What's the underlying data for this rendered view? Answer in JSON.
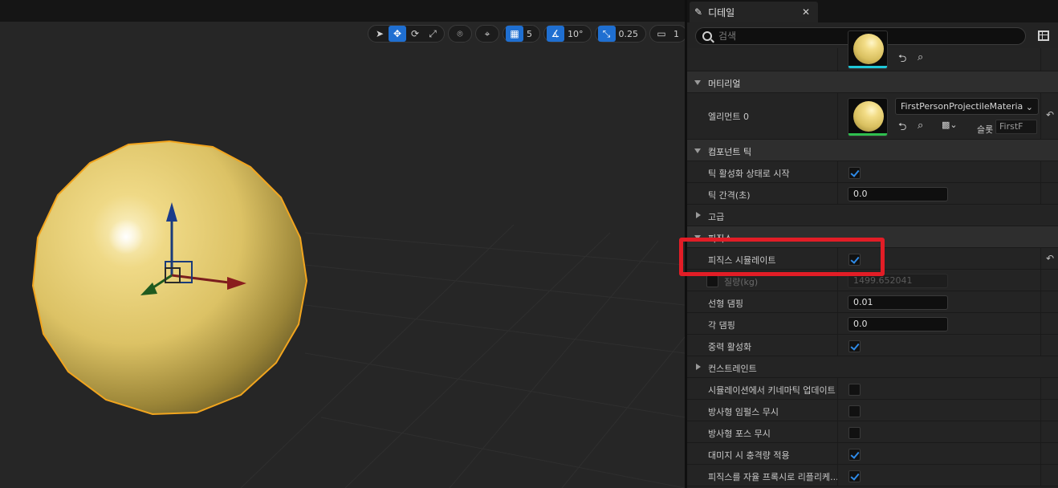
{
  "viewport": {
    "toolbar": {
      "grid_snap": "5",
      "rotation_snap": "10°",
      "scale_snap": "0.25",
      "camera_speed": "1"
    },
    "colors": {
      "background": "#262626",
      "sphere": "#e8cf6b",
      "selection_outline": "#f0a020"
    }
  },
  "details": {
    "tab_title": "디테일",
    "search_placeholder": "검색",
    "sections": {
      "material": "머티리얼",
      "component_tick": "컴포넌트 틱",
      "advanced": "고급",
      "physics": "피직스",
      "constraints": "컨스트레인트"
    },
    "material": {
      "element_label": "엘리먼트 0",
      "material_name": "FirstPersonProjectileMateria",
      "slot_label": "슬롯",
      "slot_value": "FirstF"
    },
    "tick": {
      "start_enabled_label": "틱 활성화 상태로 시작",
      "start_enabled": true,
      "interval_label": "틱 간격(초)",
      "interval_value": "0.0"
    },
    "physics": {
      "simulate_label": "피직스 시뮬레이트",
      "simulate": true,
      "mass_label": "질량(kg)",
      "mass_value": "1499.652041",
      "linear_damping_label": "선형 댐핑",
      "linear_damping_value": "0.01",
      "angular_damping_label": "각 댐핑",
      "angular_damping_value": "0.0",
      "gravity_label": "중력 활성화",
      "gravity": true,
      "kinematic_update_label": "시뮬레이션에서 키네마틱 업데이트",
      "ignore_radial_impulse_label": "방사형 임펄스 무시",
      "ignore_radial_force_label": "방사형 포스 무시",
      "damage_impulse_label": "대미지 시 충격량 적용",
      "replicate_physics_label": "피직스를 자율 프록시로 리플리케..."
    },
    "colors": {
      "accent": "#2f8be8",
      "highlight_box": "#e21d26",
      "material_bar": "#2fbf4f",
      "top_thumb_bar": "#1fc8d8"
    }
  }
}
